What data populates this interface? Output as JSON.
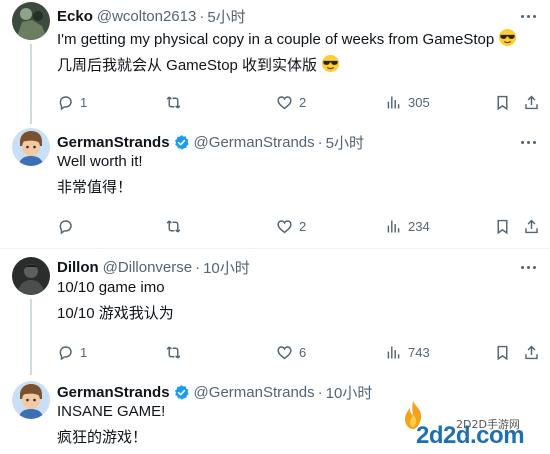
{
  "tweets": [
    {
      "name": "Ecko",
      "handle": "@wcolton2613",
      "time": "5小时",
      "verified": false,
      "text": "I'm getting my physical copy in a couple of weeks from GameStop",
      "translation": "几周后我就会从 GameStop 收到实体版",
      "has_emoji": true,
      "replies": "1",
      "retweets": "",
      "likes": "2",
      "views": "305"
    },
    {
      "name": "GermanStrands",
      "handle": "@GermanStrands",
      "time": "5小时",
      "verified": true,
      "text": "Well worth it!",
      "translation": "非常值得！",
      "has_emoji": false,
      "replies": "",
      "retweets": "",
      "likes": "2",
      "views": "234"
    },
    {
      "name": "Dillon",
      "handle": "@Dillonverse",
      "time": "10小时",
      "verified": false,
      "text": "10/10 game imo",
      "translation": "10/10 游戏我认为",
      "has_emoji": false,
      "replies": "1",
      "retweets": "",
      "likes": "6",
      "views": "743"
    },
    {
      "name": "GermanStrands",
      "handle": "@GermanStrands",
      "time": "10小时",
      "verified": true,
      "text": "INSANE GAME!",
      "translation": "疯狂的游戏！",
      "has_emoji": false
    }
  ],
  "watermark": {
    "site_cn": "2D2D手游网",
    "site": "2d2d.com"
  },
  "colors": {
    "text": "#0f1419",
    "secondary": "#536471",
    "verified": "#1d9bf0",
    "divider": "#eff3f4",
    "thread_line": "#cfd9de"
  }
}
